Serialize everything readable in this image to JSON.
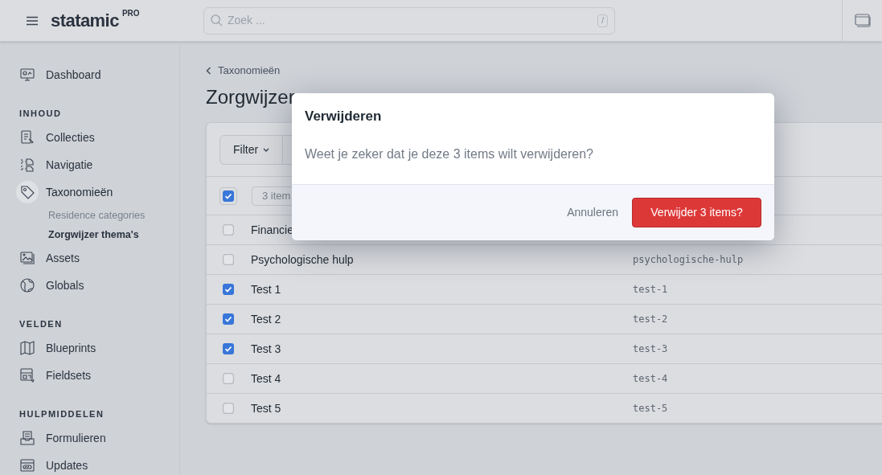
{
  "header": {
    "logo": "statamic",
    "badge": "PRO",
    "search": {
      "placeholder": "Zoek ...",
      "shortcut": "/"
    }
  },
  "sidebar": {
    "sections": [
      {
        "items": [
          {
            "label": "Dashboard",
            "selected": false
          }
        ]
      },
      {
        "heading": "INHOUD",
        "items": [
          {
            "label": "Collecties",
            "selected": false
          },
          {
            "label": "Navigatie",
            "selected": false
          },
          {
            "label": "Taxonomieën",
            "selected": true,
            "children": [
              {
                "label": "Residence categories",
                "selected": false
              },
              {
                "label": "Zorgwijzer thema's",
                "selected": true
              }
            ]
          },
          {
            "label": "Assets",
            "selected": false
          },
          {
            "label": "Globals",
            "selected": false
          }
        ]
      },
      {
        "heading": "VELDEN",
        "items": [
          {
            "label": "Blueprints",
            "selected": false
          },
          {
            "label": "Fieldsets",
            "selected": false
          }
        ]
      },
      {
        "heading": "HULPMIDDELEN",
        "items": [
          {
            "label": "Formulieren",
            "selected": false
          },
          {
            "label": "Updates",
            "selected": false
          }
        ]
      }
    ]
  },
  "breadcrumb": "Taxonomieën",
  "title": "Zorgwijzer",
  "listing": {
    "filter_button": "Filter",
    "select_all_checked": true,
    "selection_count": "3 item",
    "rows": [
      {
        "title": "Financie",
        "checked": false
      },
      {
        "title": "Psychologische hulp",
        "slug": "psychologische-hulp",
        "checked": false
      },
      {
        "title": "Test 1",
        "slug": "test-1",
        "checked": true
      },
      {
        "title": "Test 2",
        "slug": "test-2",
        "checked": true
      },
      {
        "title": "Test 3",
        "slug": "test-3",
        "checked": true
      },
      {
        "title": "Test 4",
        "slug": "test-4",
        "checked": false
      },
      {
        "title": "Test 5",
        "slug": "test-5",
        "checked": false
      }
    ]
  },
  "dialog": {
    "title": "Verwijderen",
    "message": "Weet je zeker dat je deze 3 items wilt verwijderen?",
    "cancel": "Annuleren",
    "confirm": "Verwijder 3 items?"
  }
}
